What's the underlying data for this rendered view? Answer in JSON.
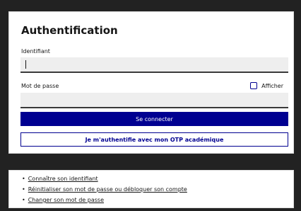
{
  "auth": {
    "title": "Authentification",
    "identifier_label": "Identifiant",
    "identifier_value": "",
    "password_label": "Mot de passe",
    "password_value": "",
    "show_password_label": "Afficher",
    "submit_label": "Se connecter",
    "otp_label": "Je m'authentifie avec mon OTP académique"
  },
  "help_links": [
    {
      "label": "Connaître son identifiant"
    },
    {
      "label": "Réinitialiser son mot de passe ou débloquer son compte"
    },
    {
      "label": "Changer son mot de passe"
    }
  ],
  "colors": {
    "page_background": "#222222",
    "primary": "#000091",
    "input_background": "#eeeeee",
    "text": "#161616"
  }
}
